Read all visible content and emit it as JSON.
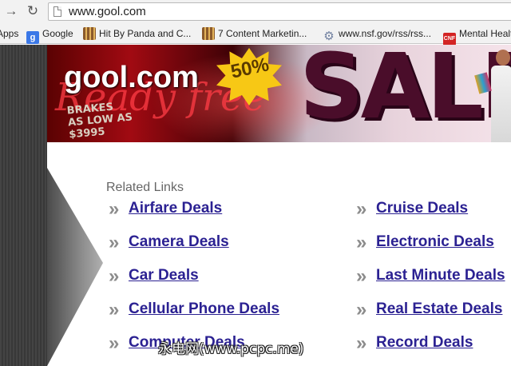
{
  "browser": {
    "url": "www.gool.com",
    "bookmarks": [
      {
        "label": "Apps",
        "icon": "apps-icon"
      },
      {
        "label": "Google",
        "icon": "google-icon"
      },
      {
        "label": "Hit By Panda and C...",
        "icon": "bookmark-icon"
      },
      {
        "label": "7 Content Marketin...",
        "icon": "bookmark-icon"
      },
      {
        "label": "www.nsf.gov/rss/rss...",
        "icon": "gear-icon"
      },
      {
        "label": "Mental Health",
        "icon": "cnf-icon"
      }
    ]
  },
  "banner": {
    "site_name": "gool.com",
    "script_text": "Ready free",
    "promo_lines": [
      "BRAKES",
      "AS LOW AS",
      "$3995"
    ],
    "percent": "50%",
    "sale_text": "SALE"
  },
  "related": {
    "title": "Related Links",
    "left": [
      "Airfare Deals",
      "Camera Deals",
      "Car Deals",
      "Cellular Phone Deals",
      "Computer Deals"
    ],
    "right": [
      "Cruise Deals",
      "Electronic Deals",
      "Last Minute Deals",
      "Real Estate Deals",
      "Record Deals"
    ]
  },
  "watermark": "永电网(www.pcpc.me)",
  "colors": {
    "link": "#2b2192",
    "chrome": "#f2f2f2",
    "side_panel": "#3f3f3f"
  }
}
